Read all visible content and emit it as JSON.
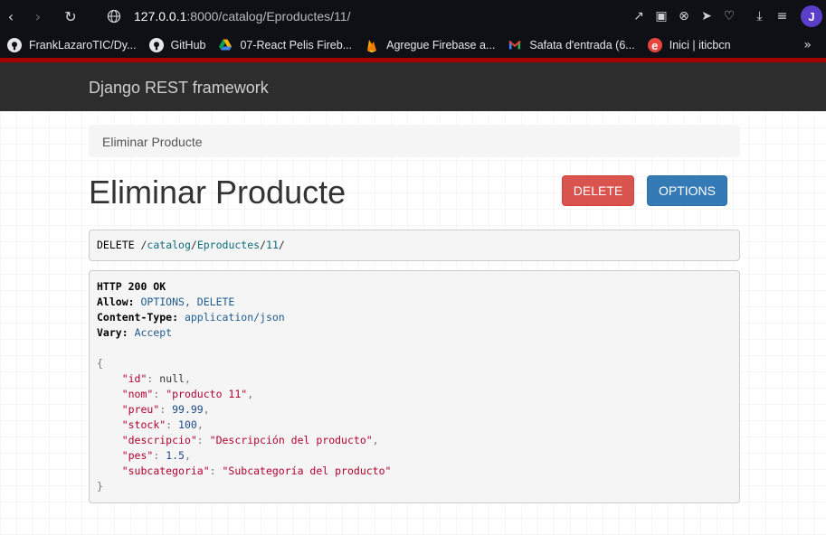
{
  "browser": {
    "url_host": "127.0.0.1",
    "url_path": ":8000/catalog/Eproductes/11/",
    "avatar_initial": "J",
    "toolbar_icons": [
      "share-icon",
      "screenshot-icon",
      "shield-icon",
      "send-icon",
      "heart-icon",
      "download-icon",
      "menu-icon"
    ],
    "bookmarks": [
      {
        "label": "FrankLazaroTIC/Dy...",
        "icon": "github-icon"
      },
      {
        "label": "GitHub",
        "icon": "github-icon"
      },
      {
        "label": "07-React Pelis Fireb...",
        "icon": "google-drive-icon"
      },
      {
        "label": "Agregue Firebase a...",
        "icon": "firebase-icon"
      },
      {
        "label": "Safata d'entrada (6...",
        "icon": "gmail-icon"
      },
      {
        "label": "Inici | iticbcn",
        "icon": "edge-e-icon"
      }
    ]
  },
  "navbar": {
    "brand": "Django REST framework"
  },
  "breadcrumb": {
    "label": "Eliminar Producte"
  },
  "page": {
    "title": "Eliminar Producte",
    "delete_label": "DELETE",
    "options_label": "OPTIONS"
  },
  "request": {
    "method": "DELETE",
    "path_parts": [
      "catalog",
      "Eproductes",
      "11"
    ]
  },
  "response": {
    "status": "HTTP 200 OK",
    "headers": [
      {
        "key": "Allow",
        "value": "OPTIONS, DELETE"
      },
      {
        "key": "Content-Type",
        "value": "application/json"
      },
      {
        "key": "Vary",
        "value": "Accept"
      }
    ],
    "body": [
      {
        "key": "\"id\"",
        "value": "null",
        "type": "null"
      },
      {
        "key": "\"nom\"",
        "value": "\"producto 11\"",
        "type": "str"
      },
      {
        "key": "\"preu\"",
        "value": "99.99",
        "type": "num"
      },
      {
        "key": "\"stock\"",
        "value": "100",
        "type": "num"
      },
      {
        "key": "\"descripcio\"",
        "value": "\"Descripción del producto\"",
        "type": "str"
      },
      {
        "key": "\"pes\"",
        "value": "1.5",
        "type": "num"
      },
      {
        "key": "\"subcategoria\"",
        "value": "\"Subcategoría del producto\"",
        "type": "str"
      }
    ]
  },
  "colors": {
    "navbar_bg": "#2d2d2d",
    "navbar_accent": "#a30000",
    "delete_btn": "#d9534f",
    "options_btn": "#337ab7"
  }
}
